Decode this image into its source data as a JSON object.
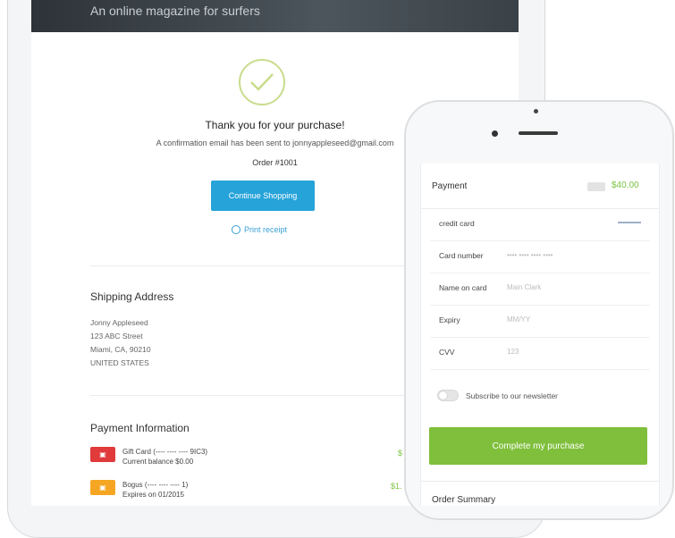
{
  "tablet": {
    "tagline": "An online magazine for surfers",
    "thanks": "Thank you for your purchase!",
    "email_note": "A confirmation email has been sent to jonnyappleseed@gmail.com",
    "order_number": "Order #1001",
    "continue_button": "Continue Shopping",
    "print_receipt": "Print receipt",
    "shipping": {
      "title": "Shipping Address",
      "lines": [
        "Jonny Appleseed",
        "123 ABC Street",
        "Miami, CA, 90210",
        "UNITED STATES"
      ]
    },
    "payment": {
      "title": "Payment Information",
      "methods": [
        {
          "name": "Gift Card (---- ---- ---- 9IC3)",
          "detail": "Current balance $0.00",
          "amount": "$",
          "color": "#e03a3a"
        },
        {
          "name": "Bogus (---- ---- ---- 1)",
          "detail": "Expires on 01/2015",
          "amount": "$1.",
          "color": "#f5a623"
        }
      ]
    }
  },
  "phone": {
    "title": "Payment",
    "total": "$40.00",
    "fields": [
      {
        "label": "credit card",
        "placeholder": ""
      },
      {
        "label": "Card number",
        "placeholder": "•••• •••• •••• ••••"
      },
      {
        "label": "Name on card",
        "placeholder": "Main Clark"
      },
      {
        "label": "Expiry",
        "placeholder": "MM/YY"
      },
      {
        "label": "CVV",
        "placeholder": "123"
      }
    ],
    "newsletter": "Subscribe to our newsletter",
    "cta": "Complete my purchase",
    "summary": "Order Summary"
  },
  "colors": {
    "accent_blue": "#26a3d9",
    "accent_green": "#7fbf3c"
  }
}
